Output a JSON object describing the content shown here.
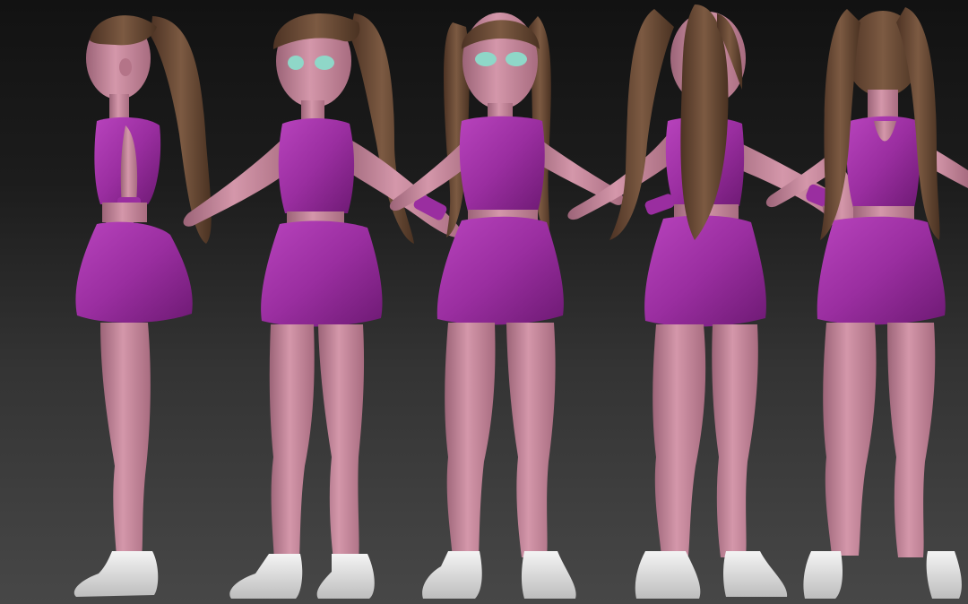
{
  "scene": {
    "subject": "character-turnaround",
    "views": [
      {
        "name": "side-left",
        "facing": "left"
      },
      {
        "name": "three-quarter-front",
        "facing": "front-left"
      },
      {
        "name": "front",
        "facing": "front"
      },
      {
        "name": "three-quarter-back",
        "facing": "back-right"
      },
      {
        "name": "back",
        "facing": "back"
      }
    ],
    "colors": {
      "background_top": "#121212",
      "background_bottom": "#474747",
      "skin": "#c9889c",
      "outfit": "#9a2ea0",
      "hair": "#6b4a35",
      "shoes": "#e8e8e8",
      "eyes": "#8fd7c8"
    }
  }
}
